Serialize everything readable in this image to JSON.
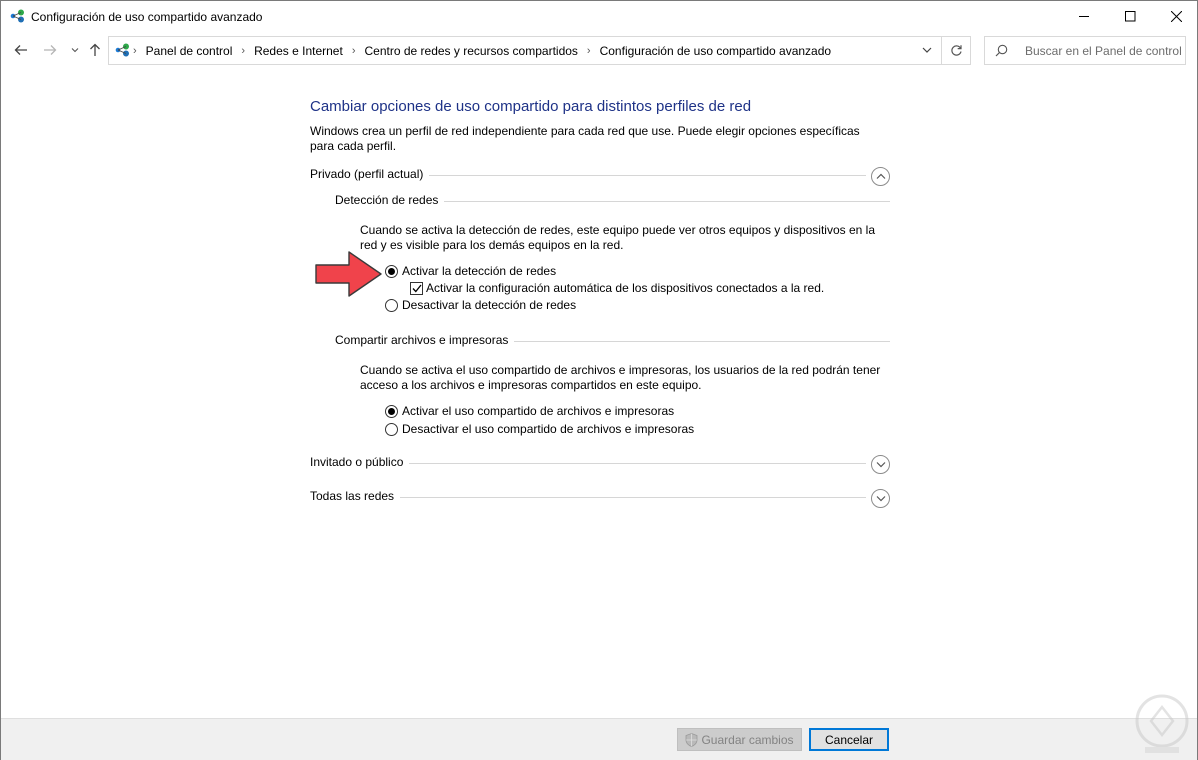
{
  "window": {
    "title": "Configuración de uso compartido avanzado",
    "app_icon": "network-icon"
  },
  "nav": {
    "breadcrumbs": [
      "Panel de control",
      "Redes e Internet",
      "Centro de redes y recursos compartidos",
      "Configuración de uso compartido avanzado"
    ],
    "search_placeholder": "Buscar en el Panel de control"
  },
  "main": {
    "heading": "Cambiar opciones de uso compartido para distintos perfiles de red",
    "description": "Windows crea un perfil de red independiente para cada red que use. Puede elegir opciones específicas para cada perfil."
  },
  "profiles": {
    "private": {
      "label": "Privado (perfil actual)",
      "expanded": true,
      "network_discovery": {
        "title": "Detección de redes",
        "description": "Cuando se activa la detección de redes, este equipo puede ver otros equipos y dispositivos en la red y es visible para los demás equipos en la red.",
        "on_label": "Activar la detección de redes",
        "auto_config_label": "Activar la configuración automática de los dispositivos conectados a la red.",
        "off_label": "Desactivar la detección de redes",
        "selected": "on",
        "auto_config_checked": true
      },
      "file_sharing": {
        "title": "Compartir archivos e impresoras",
        "description": "Cuando se activa el uso compartido de archivos e impresoras, los usuarios de la red podrán tener acceso a los archivos e impresoras compartidos en este equipo.",
        "on_label": "Activar el uso compartido de archivos e impresoras",
        "off_label": "Desactivar el uso compartido de archivos e impresoras",
        "selected": "on"
      }
    },
    "guest": {
      "label": "Invitado o público",
      "expanded": false
    },
    "all": {
      "label": "Todas las redes",
      "expanded": false
    }
  },
  "footer": {
    "save_label": "Guardar cambios",
    "save_enabled": false,
    "cancel_label": "Cancelar"
  },
  "colors": {
    "heading": "#1e3287",
    "annotation_arrow": "#f0434b",
    "focus_border": "#0078d7"
  }
}
